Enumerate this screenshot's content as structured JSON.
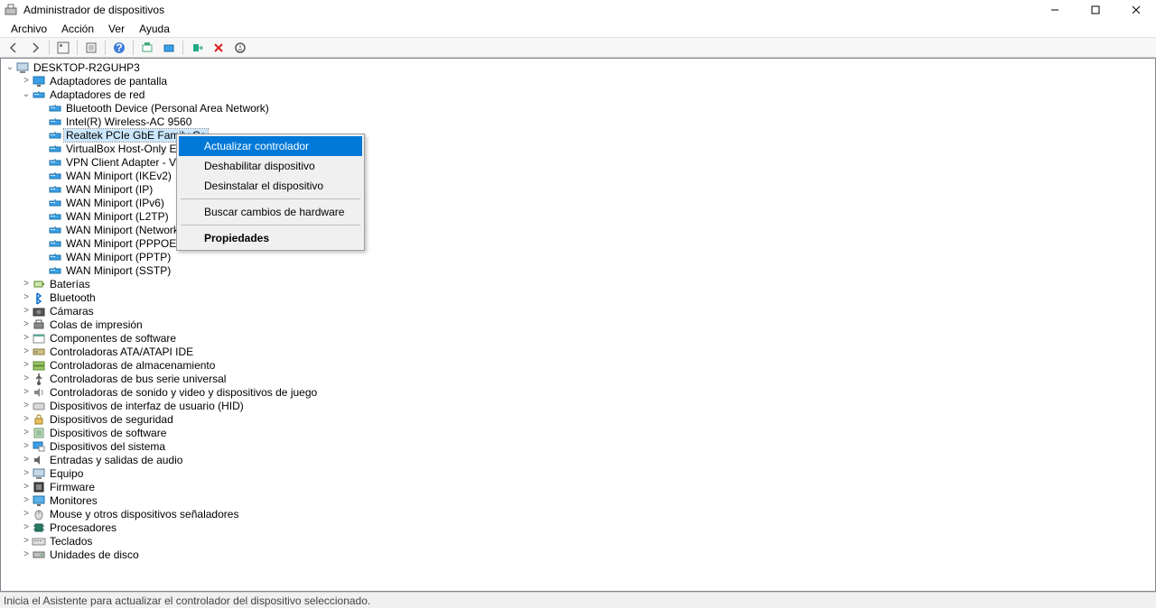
{
  "window": {
    "title": "Administrador de dispositivos"
  },
  "menu": {
    "file": "Archivo",
    "action": "Acción",
    "view": "Ver",
    "help": "Ayuda"
  },
  "tree": {
    "root": "DESKTOP-R2GUHP3",
    "categories": [
      {
        "label": "Adaptadores de pantalla",
        "icon": "monitor",
        "expanded": false
      },
      {
        "label": "Adaptadores de red",
        "icon": "network",
        "expanded": true,
        "children": [
          "Bluetooth Device (Personal Area Network)",
          "Intel(R) Wireless-AC 9560",
          "Realtek PCIe GbE Family Co",
          "VirtualBox Host-Only Ethern",
          "VPN Client Adapter - VPN2",
          "WAN Miniport (IKEv2)",
          "WAN Miniport (IP)",
          "WAN Miniport (IPv6)",
          "WAN Miniport (L2TP)",
          "WAN Miniport (Network Monitor)",
          "WAN Miniport (PPPOE)",
          "WAN Miniport (PPTP)",
          "WAN Miniport (SSTP)"
        ]
      },
      {
        "label": "Baterías",
        "icon": "battery",
        "expanded": false
      },
      {
        "label": "Bluetooth",
        "icon": "bluetooth",
        "expanded": false
      },
      {
        "label": "Cámaras",
        "icon": "camera",
        "expanded": false
      },
      {
        "label": "Colas de impresión",
        "icon": "printer",
        "expanded": false
      },
      {
        "label": "Componentes de software",
        "icon": "software",
        "expanded": false
      },
      {
        "label": "Controladoras ATA/ATAPI IDE",
        "icon": "ide",
        "expanded": false
      },
      {
        "label": "Controladoras de almacenamiento",
        "icon": "storage",
        "expanded": false
      },
      {
        "label": "Controladoras de bus serie universal",
        "icon": "usb",
        "expanded": false
      },
      {
        "label": "Controladoras de sonido y video y dispositivos de juego",
        "icon": "audio",
        "expanded": false
      },
      {
        "label": "Dispositivos de interfaz de usuario (HID)",
        "icon": "hid",
        "expanded": false
      },
      {
        "label": "Dispositivos de seguridad",
        "icon": "security",
        "expanded": false
      },
      {
        "label": "Dispositivos de software",
        "icon": "software2",
        "expanded": false
      },
      {
        "label": "Dispositivos del sistema",
        "icon": "system",
        "expanded": false
      },
      {
        "label": "Entradas y salidas de audio",
        "icon": "audioio",
        "expanded": false
      },
      {
        "label": "Equipo",
        "icon": "computer",
        "expanded": false
      },
      {
        "label": "Firmware",
        "icon": "firmware",
        "expanded": false
      },
      {
        "label": "Monitores",
        "icon": "monitor2",
        "expanded": false
      },
      {
        "label": "Mouse y otros dispositivos señaladores",
        "icon": "mouse",
        "expanded": false
      },
      {
        "label": "Procesadores",
        "icon": "processor",
        "expanded": false
      },
      {
        "label": "Teclados",
        "icon": "keyboard",
        "expanded": false
      },
      {
        "label": "Unidades de disco",
        "icon": "disk",
        "expanded": false
      }
    ],
    "selected_child_index": 2
  },
  "context_menu": {
    "items": [
      {
        "label": "Actualizar controlador",
        "highlighted": true
      },
      {
        "label": "Deshabilitar dispositivo"
      },
      {
        "label": "Desinstalar el dispositivo"
      },
      {
        "sep": true
      },
      {
        "label": "Buscar cambios de hardware"
      },
      {
        "sep": true
      },
      {
        "label": "Propiedades",
        "bold": true
      }
    ]
  },
  "statusbar": {
    "text": "Inicia el Asistente para actualizar el controlador del dispositivo seleccionado."
  }
}
